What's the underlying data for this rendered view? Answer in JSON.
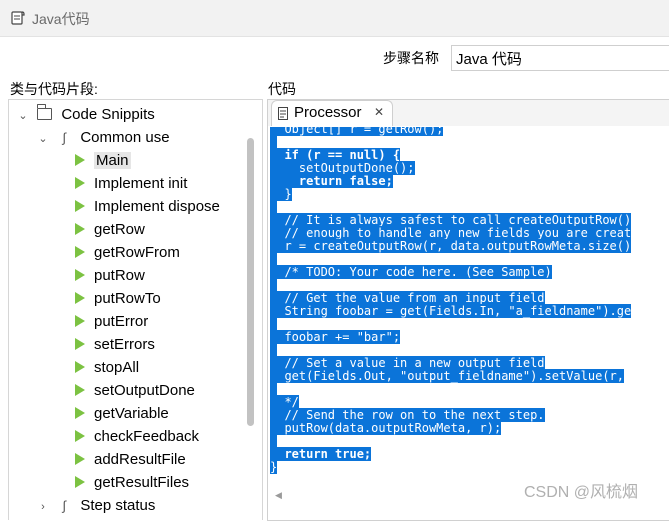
{
  "window": {
    "title": "Java代码"
  },
  "step": {
    "label": "步骤名称",
    "value": "Java 代码"
  },
  "left_panel": {
    "header": "类与代码片段:"
  },
  "right_panel": {
    "header": "代码"
  },
  "tree": {
    "root": "Code Snippits",
    "group": "Common use",
    "items": [
      "Main",
      "Implement init",
      "Implement dispose",
      "getRow",
      "getRowFrom",
      "putRow",
      "putRowTo",
      "putError",
      "setErrors",
      "stopAll",
      "setOutputDone",
      "getVariable",
      "checkFeedback",
      "addResultFile",
      "getResultFiles"
    ],
    "selected": "Main",
    "next_group": "Step status"
  },
  "editor": {
    "tab_label": "Processor",
    "code_lines": [
      "  Object[] r = getRow();",
      "",
      "  if (r == null) {",
      "    setOutputDone();",
      "    return false;",
      "  }",
      "",
      "  // It is always safest to call createOutputRow()",
      "  // enough to handle any new fields you are creat",
      "  r = createOutputRow(r, data.outputRowMeta.size()",
      "",
      "  /* TODO: Your code here. (See Sample)",
      "",
      "  // Get the value from an input field",
      "  String foobar = get(Fields.In, \"a_fieldname\").ge",
      "",
      "  foobar += \"bar\";",
      "",
      "  // Set a value in a new output field",
      "  get(Fields.Out, \"output_fieldname\").setValue(r,",
      "",
      "  */",
      "  // Send the row on to the next step.",
      "  putRow(data.outputRowMeta, r);",
      "",
      "  return true;",
      "}"
    ]
  },
  "watermark": "CSDN @风梳烟",
  "colors": {
    "selection": "#0b74d9",
    "snippet_icon": "#7cc242"
  }
}
